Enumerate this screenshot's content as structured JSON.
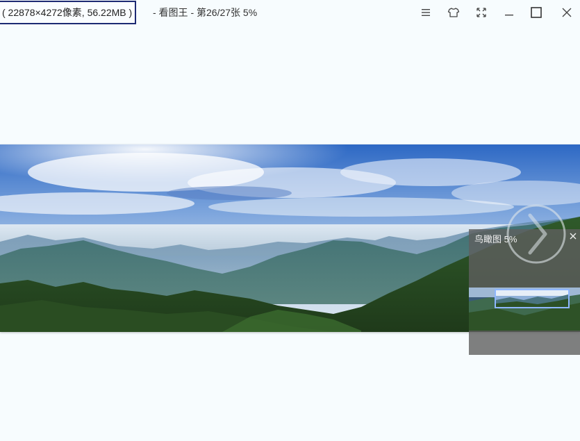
{
  "titlebar": {
    "file_info": "( 22878×4272像素, 56.22MB )",
    "app_title": "- 看图王 - 第26/27张 5%"
  },
  "window_controls": {
    "icons": [
      "menu-icon",
      "skin-shirt-icon",
      "fullscreen-icon",
      "minimize-icon",
      "maximize-icon",
      "close-icon"
    ]
  },
  "navigator": {
    "title": "鸟瞰图 5%"
  },
  "colors": {
    "background": "#f7fcfe",
    "file_info_border": "#1d2a73",
    "navigator_bg": "#5f5f5f",
    "navigator_viewport": "#8fb7ff"
  }
}
